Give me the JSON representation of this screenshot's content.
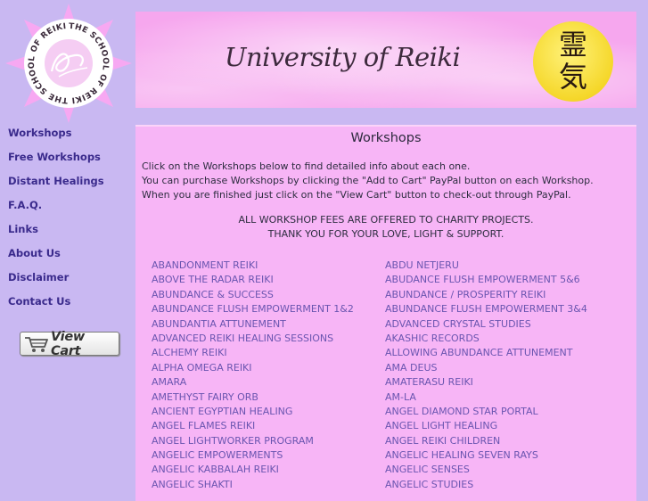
{
  "logo": {
    "ring_text": "THE SCHOOL OF REIKI  THE SCHOOL OF REIKI  THE SCHOOL OF REIKI"
  },
  "nav": {
    "items": [
      {
        "label": "Workshops"
      },
      {
        "label": "Free Workshops"
      },
      {
        "label": "Distant Healings"
      },
      {
        "label": "F.A.Q."
      },
      {
        "label": "Links"
      },
      {
        "label": "About Us"
      },
      {
        "label": "Disclaimer"
      },
      {
        "label": "Contact Us"
      }
    ],
    "view_cart_label": "View Cart"
  },
  "header": {
    "title": "University of Reiki",
    "kanji_top": "霊",
    "kanji_bottom": "気"
  },
  "content": {
    "heading": "Workshops",
    "intro": [
      "Click on the Workshops below to find detailed info about each one.",
      "You can purchase Workshops by clicking the \"Add to Cart\" PayPal button on each Workshop.",
      "When you are finished just click on the \"View Cart\" button to check-out through PayPal."
    ],
    "notice": [
      "ALL WORKSHOP FEES ARE OFFERED TO CHARITY PROJECTS.",
      "THANK YOU FOR YOUR LOVE, LIGHT & SUPPORT."
    ],
    "workshops_left": [
      "ABANDONMENT REIKI",
      "ABOVE THE RADAR REIKI",
      "ABUNDANCE & SUCCESS",
      "ABUNDANCE FLUSH EMPOWERMENT 1&2",
      "ABUNDANTIA ATTUNEMENT",
      "ADVANCED REIKI HEALING SESSIONS",
      "ALCHEMY REIKI",
      "ALPHA OMEGA REIKI",
      "AMARA",
      "AMETHYST FAIRY ORB",
      "ANCIENT EGYPTIAN HEALING",
      "ANGEL FLAMES REIKI",
      "ANGEL LIGHTWORKER PROGRAM",
      "ANGELIC EMPOWERMENTS",
      "ANGELIC KABBALAH REIKI",
      "ANGELIC SHAKTI"
    ],
    "workshops_right": [
      "ABDU NETJERU",
      "ABUDANCE FLUSH EMPOWERMENT 5&6",
      "ABUNDANCE / PROSPERITY REIKI",
      "ABUNDANCE FLUSH EMPOWERMENT 3&4",
      "ADVANCED CRYSTAL STUDIES",
      "AKASHIC RECORDS",
      "ALLOWING ABUNDANCE ATTUNEMENT",
      "AMA DEUS",
      "AMATERASU REIKI",
      "AM-LA",
      "ANGEL DIAMOND STAR PORTAL",
      "ANGEL LIGHT HEALING",
      "ANGEL REIKI CHILDREN",
      "ANGELIC HEALING SEVEN RAYS",
      "ANGELIC SENSES",
      "ANGELIC STUDIES"
    ]
  },
  "colors": {
    "page_background": "#c9b8f2",
    "content_background": "#f7b5f6",
    "header_pink": "#f6a7ee",
    "logo_star": "#f7a8f2",
    "link_color": "#6a55b0",
    "nav_color": "#3a2a8c",
    "badge_yellow": "#f5d72a"
  }
}
